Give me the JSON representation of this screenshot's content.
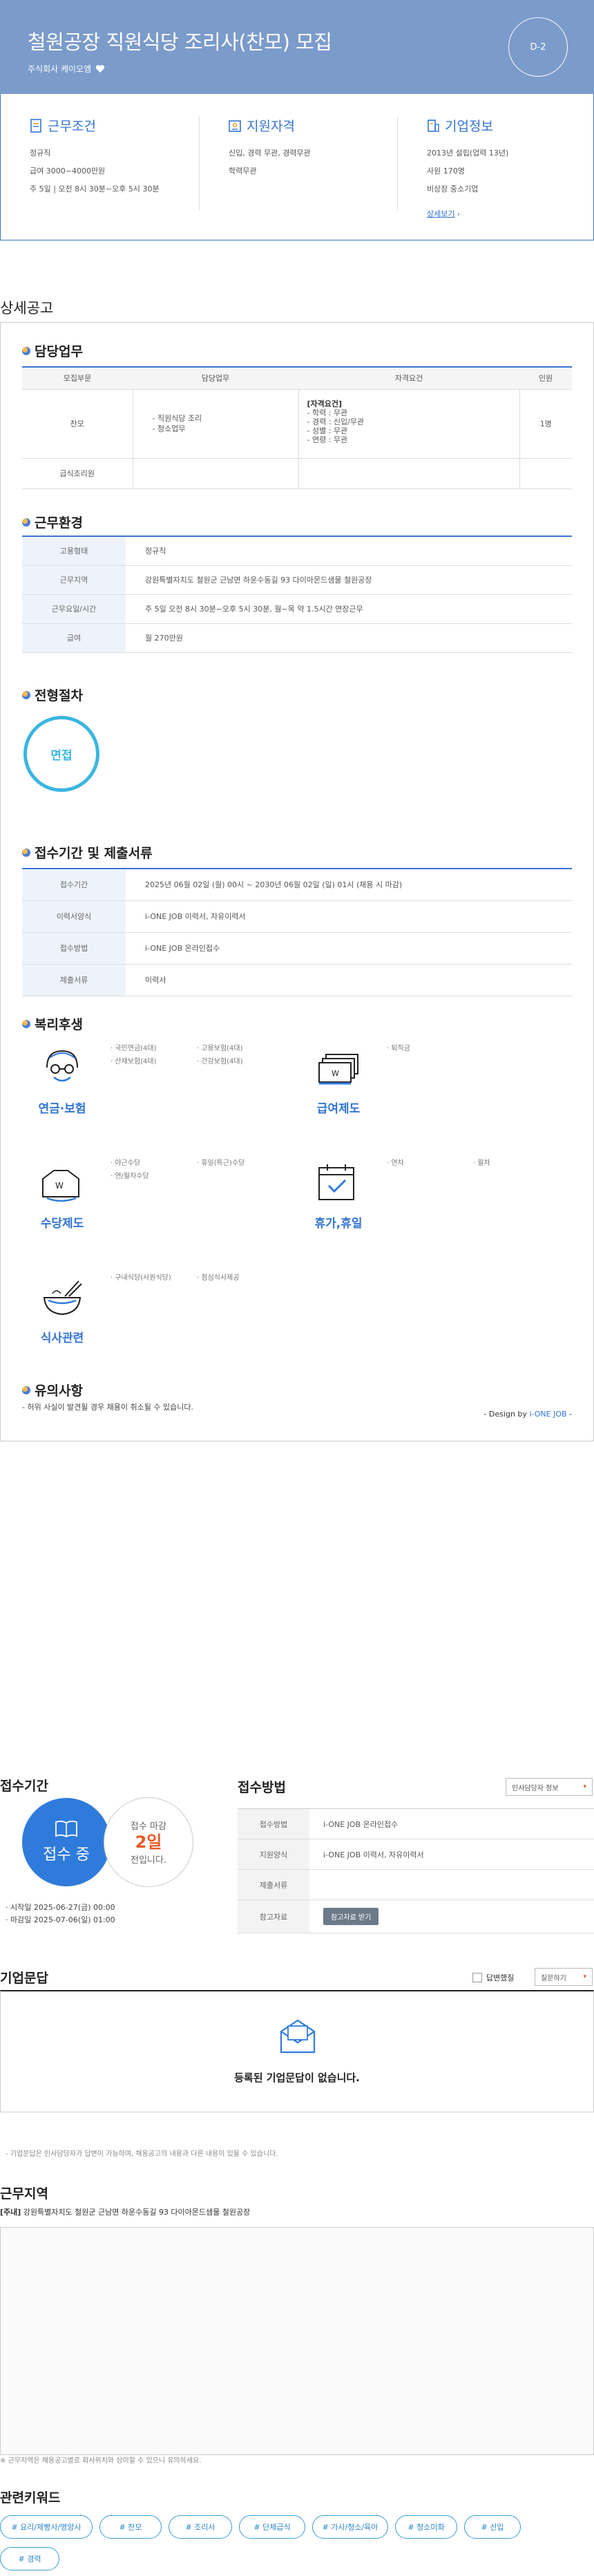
{
  "header": {
    "title": "철원공장 직원식당 조리사(찬모) 모집",
    "company": "주식회사 케이오엠",
    "dday": "D-2"
  },
  "summary": {
    "work": {
      "title": "근무조건",
      "items": [
        "정규직",
        "급여 3000~4000만원",
        "주 5일 | 오전 8시 30분~오후 5시 30분"
      ]
    },
    "qualify": {
      "title": "지원자격",
      "items": [
        "신입, 경력 무관, 경력무관",
        "학력무관"
      ]
    },
    "company": {
      "title": "기업정보",
      "items": [
        "2013년 설립(업력 13년)",
        "사원 170명",
        "비상장 중소기업"
      ],
      "more": "상세보기"
    }
  },
  "detail": {
    "heading": "상세공고",
    "duty": {
      "title": "담당업무",
      "headers": [
        "모집부문",
        "담당업무",
        "자격요건",
        "인원"
      ],
      "rows": [
        {
          "dept": "찬모",
          "tasks": [
            "- 직원식당 조리",
            "- 청소업무"
          ],
          "req_title": "[자격요건]",
          "reqs": [
            "- 학력 : 무관",
            "- 경력 : 신입/무관",
            "- 성별 : 무관",
            "- 연령 : 무관"
          ],
          "count": "1명"
        },
        {
          "dept": "급식조리원",
          "tasks": [],
          "req_title": "",
          "reqs": [],
          "count": ""
        }
      ]
    },
    "env": {
      "title": "근무환경",
      "rows": [
        {
          "k": "고용형태",
          "v": "정규직"
        },
        {
          "k": "근무지역",
          "v": "강원특별자치도 철원군 근남면 하운수동길 93 다이아몬드샘물 철원공장"
        },
        {
          "k": "근무요일/시간",
          "v": "주 5일 오전 8시 30분~오후 5시 30분, 월~목 약 1.5시간 연장근무"
        },
        {
          "k": "급여",
          "v": "월 270만원"
        }
      ]
    },
    "process": {
      "title": "전형절차",
      "step": "면접"
    },
    "apply_period": {
      "title": "접수기간 및 제출서류",
      "rows": [
        {
          "k": "접수기간",
          "v": "2025년 06월 02일 (월) 00시 ~ 2030년 06월 02일 (일) 01시 (채용 시 마감)"
        },
        {
          "k": "이력서양식",
          "v": "i-ONE JOB 이력서, 자유이력서"
        },
        {
          "k": "접수방법",
          "v": "i-ONE JOB 온라인접수"
        },
        {
          "k": "제출서류",
          "v": "이력서"
        }
      ]
    },
    "welfare": {
      "title": "복리후생",
      "groups": [
        {
          "name": "연금·보험",
          "icon": "pension-icon",
          "items": [
            "· 국민연금(4대)",
            "· 고용보험(4대)",
            "· 산재보험(4대)",
            "· 건강보험(4대)"
          ]
        },
        {
          "name": "급여제도",
          "icon": "salary-icon",
          "items": [
            "· 퇴직금"
          ]
        },
        {
          "name": "수당제도",
          "icon": "allowance-icon",
          "items": [
            "· 야근수당",
            "· 휴일(특근)수당",
            "· 연/월차수당"
          ]
        },
        {
          "name": "휴가,휴일",
          "icon": "calendar-icon",
          "items": [
            "· 연차",
            "· 월차"
          ]
        },
        {
          "name": "식사관련",
          "icon": "meal-icon",
          "items": [
            "· 구내식당(사원식당)",
            "· 점심식사제공"
          ]
        }
      ]
    },
    "notice": {
      "title": "유의사항",
      "text": "- 허위 사실이 발견될 경우 채용이 취소될 수 있습니다.",
      "design_prefix": "- Design by ",
      "design_brand": "i-ONE JOB",
      "design_suffix": " -"
    }
  },
  "apply": {
    "period_title": "접수기간",
    "status": "접수 중",
    "deadline_label": "접수 마감",
    "deadline_days": "2일",
    "deadline_suffix": "전입니다.",
    "start": "· 시작일 2025-06-27(금) 00:00",
    "end": "· 마감일 2025-07-06(일) 01:00",
    "method_title": "접수방법",
    "manager_select": "인사담당자 정보",
    "rows": [
      {
        "k": "접수방법",
        "v": "i-ONE JOB 온라인접수"
      },
      {
        "k": "지원양식",
        "v": "i-ONE JOB 이력서, 자유이력서"
      },
      {
        "k": "제출서류",
        "v": ""
      },
      {
        "k": "참고자료",
        "v": ""
      }
    ],
    "ref_button": "참고자료 받기"
  },
  "qna": {
    "title": "기업문답",
    "answered_label": "답변했질",
    "sort_select": "질문하기",
    "empty": "등록된 기업문답이 없습니다.",
    "note": "- 기업문답은 인사담당자가 답변이 가능하며, 채용공고의 내용과 다른 내용이 있을 수 있습니다."
  },
  "location": {
    "title": "근무지역",
    "prefix": "[주내]",
    "address": "강원특별자치도 철원군 근남면 하운수동길 93 다이아몬드샘물 철원공장",
    "note": "※ 근무지역은 채용공고별로 회사위치와 상이할 수 있으니 유의하세요."
  },
  "keywords": {
    "title": "관련키워드",
    "tags": [
      "# 요리/제빵사/영양사",
      "# 찬모",
      "# 조리사",
      "# 단체급식",
      "# 가사/청소/육아",
      "# 청소미화",
      "# 신입",
      "# 경력"
    ]
  }
}
